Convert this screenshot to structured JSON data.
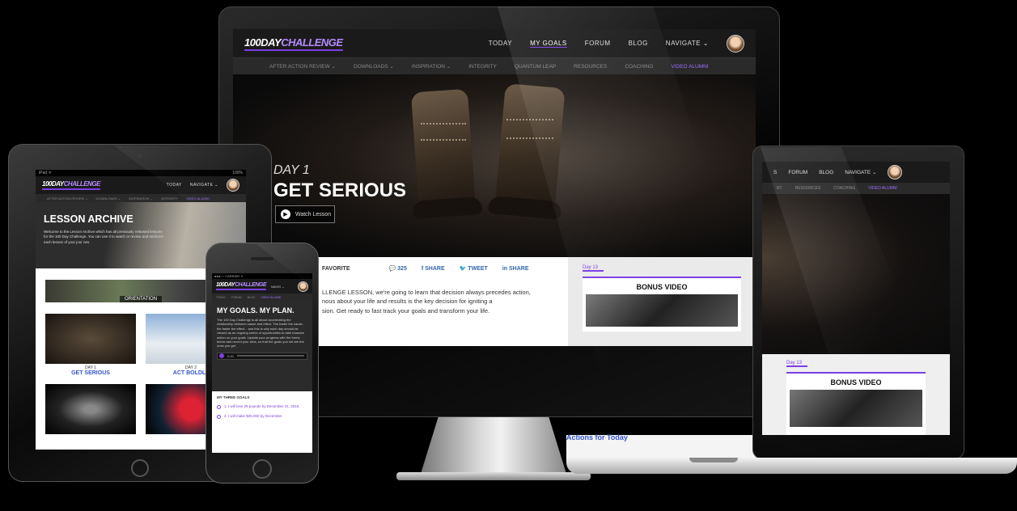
{
  "brand": {
    "logo_main": "100DAY",
    "logo_accent": "CHALLENGE",
    "accent_color": "#7b3fe4"
  },
  "desktop": {
    "menu": [
      "TODAY",
      "MY GOALS",
      "FORUM",
      "BLOG",
      "NAVIGATE ⌄"
    ],
    "subnav": [
      "AFTER ACTION REVIEW ⌄",
      "DOWNLOADS ⌄",
      "INSPIRATION ⌄",
      "INTEGRITY",
      "QUANTUM LEAP",
      "RESOURCES",
      "COACHING",
      "VIDEO ALUMNI"
    ],
    "hero": {
      "day": "DAY 1",
      "title": "GET SERIOUS",
      "watch_label": "Watch Lesson"
    },
    "social": {
      "favorite": "FAVORITE",
      "comments": "325",
      "share_fb": "SHARE",
      "tweet": "TWEET",
      "share_in": "SHARE"
    },
    "lesson_text": [
      "LLENGE LESSON, we're going to learn that decision always precedes action,",
      "nous about your life and results is the key decision for igniting a",
      "sion. Get ready to fast track your goals and transform your life."
    ],
    "sidebar": {
      "day_tab": "Day 13",
      "bonus_title": "BONUS VIDEO"
    }
  },
  "laptop": {
    "menu": [
      "S",
      "FORUM",
      "BLOG",
      "NAVIGATE ⌄"
    ],
    "subnav": [
      "RT",
      "RESOURCES",
      "COACHING",
      "VIDEO ALUMNI"
    ],
    "day_tab": "Day 13",
    "bonus_title": "BONUS VIDEO",
    "footer_text": "Actions for Today"
  },
  "tablet": {
    "status_left": "iPad ᯤ",
    "status_right": "100%",
    "menu": [
      "TODAY",
      "NAVIGATE ⌄"
    ],
    "subnav": [
      "AFTER ACTION REVIEW ⌄",
      "DOWNLOADS ⌄",
      "INSPIRATION ⌄",
      "INTEGRITY",
      "VIDEO ALUMNI"
    ],
    "title": "LESSON ARCHIVE",
    "intro": "Welcome to the Lesson Archive which has all previously released lessons for the 100 Day Challenge. You can use it to watch or review and reinforce each lesson of your jour nes.",
    "orientation": "ORIENTATION",
    "lessons": [
      {
        "day": "DAY 1",
        "name": "GET SERIOUS"
      },
      {
        "day": "DAY 2",
        "name": "ACT BOLDLY"
      },
      {
        "day": "",
        "name": ""
      },
      {
        "day": "",
        "name": ""
      }
    ]
  },
  "phone": {
    "status": "●●●○○ CARRIER ᯤ",
    "nav_label": "NAVIG ⌄",
    "subnav": [
      "TODAY",
      "FORUM",
      "BLOG",
      "VIDEO ALUMNI"
    ],
    "title": "MY GOALS. MY PLAN.",
    "body": "The 100 Day Challenge is all about accelerating the relationship between cause and effect. The faster the cause, the faster the effect... and this is why each day should be viewed as an ongoing series of opportunities to take massive action on your goals. Update your progress with the forms below and record your wins, so that the goals you set are the ones you get.",
    "audio_label": "0:00",
    "goals_header": "MY THREE GOALS",
    "goals": [
      "1.  I will lose 25 pounds by December 31, 2015.",
      "2.  I will make $35,000 by December"
    ]
  }
}
